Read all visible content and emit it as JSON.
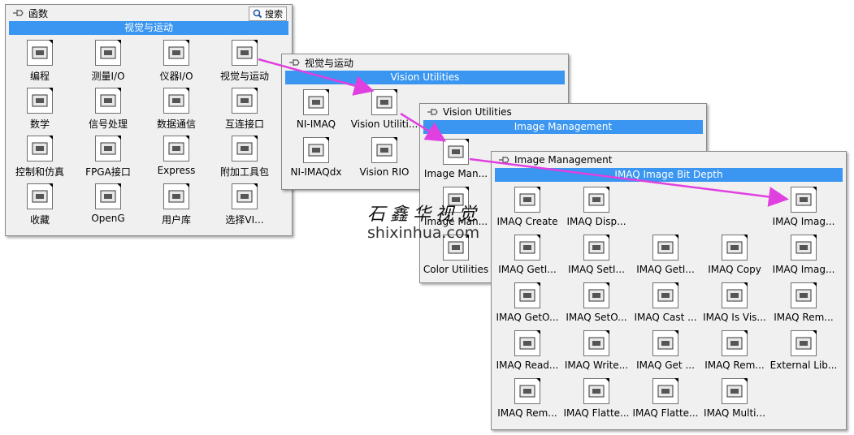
{
  "p1": {
    "title": "函数",
    "search": "搜索",
    "header": "视觉与运动",
    "items": [
      "编程",
      "测量I/O",
      "仪器I/O",
      "视觉与运动",
      "数学",
      "信号处理",
      "数据通信",
      "互连接口",
      "控制和仿真",
      "FPGA接口",
      "Express",
      "附加工具包",
      "收藏",
      "OpenG",
      "用户库",
      "选择VI..."
    ]
  },
  "p2": {
    "title": "视觉与运动",
    "header": "Vision Utilities",
    "items": [
      "NI-IMAQ",
      "Vision Utiliti...",
      "NI-IMAQdx",
      "Vision RIO"
    ]
  },
  "p3": {
    "title": "Vision Utilities",
    "header": "Image Management",
    "items": [
      "Image Man...",
      "Image Man...",
      "Color Utilities"
    ]
  },
  "p4": {
    "title": "Image Management",
    "header": "IMAQ Image Bit Depth",
    "items": [
      "IMAQ Create",
      "IMAQ Disp...",
      "IMAQ Imag...",
      "IMAQ GetI...",
      "IMAQ SetI...",
      "IMAQ GetI...",
      "IMAQ Copy",
      "IMAQ Imag...",
      "IMAQ GetO...",
      "IMAQ SetO...",
      "IMAQ Cast ...",
      "IMAQ Is Vis...",
      "IMAQ Rem...",
      "IMAQ Read...",
      "IMAQ Write...",
      "IMAQ Get ...",
      "IMAQ Rem...",
      "External Lib...",
      "IMAQ Rem...",
      "IMAQ Flatte...",
      "IMAQ Flatte...",
      "IMAQ Multi..."
    ]
  },
  "watermark": {
    "cn": "石鑫华视觉",
    "url": "shixinhua.com"
  },
  "colors": {
    "accent": "#3a96f0",
    "arrow": "#e040e0"
  }
}
